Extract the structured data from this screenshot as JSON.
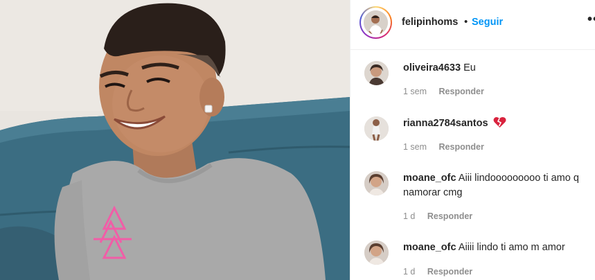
{
  "post": {
    "username": "felipinhoms",
    "separator": "•",
    "follow_label": "Seguir",
    "more_label": "•••"
  },
  "comments": [
    {
      "username": "oliveira4633",
      "text": "Eu",
      "time": "1 sem",
      "reply_label": "Responder"
    },
    {
      "username": "rianna2784santos",
      "text": "",
      "emoji": "broken-heart-emoji",
      "time": "1 sem",
      "reply_label": "Responder"
    },
    {
      "username": "moane_ofc",
      "text": "Aiii lindooooooooo ti amo q namorar cmg",
      "time": "1 d",
      "reply_label": "Responder"
    },
    {
      "username": "moane_ofc",
      "text": "Aiiii lindo ti amo m amor",
      "time": "1 d",
      "reply_label": "Responder"
    }
  ],
  "colors": {
    "link": "#0095f6",
    "text": "#262626",
    "meta": "#8e8e8e",
    "couch": "#3a6c80",
    "shirt": "#a9a9a9",
    "logo": "#f15da7"
  }
}
